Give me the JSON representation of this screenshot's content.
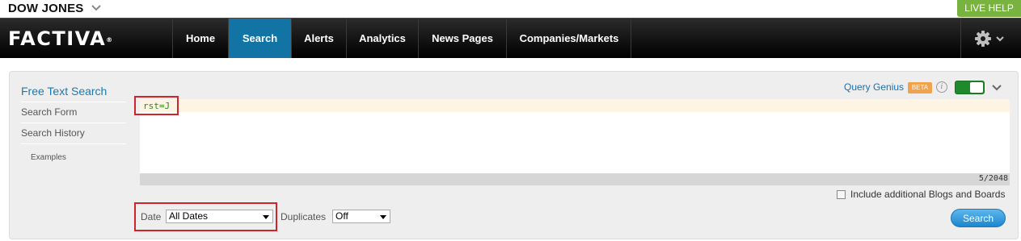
{
  "topbar": {
    "brand": "DOW JONES",
    "live_help": "LIVE HELP"
  },
  "nav": {
    "logo": "FACTIVA",
    "logo_mark": "®",
    "tabs": [
      {
        "label": "Home"
      },
      {
        "label": "Search",
        "active": true
      },
      {
        "label": "Alerts"
      },
      {
        "label": "Analytics"
      },
      {
        "label": "News Pages"
      },
      {
        "label": "Companies/Markets"
      }
    ]
  },
  "sidebar": {
    "items": [
      {
        "label": "Free Text Search",
        "active": true
      },
      {
        "label": "Search Form"
      },
      {
        "label": "Search History"
      },
      {
        "label": "Examples"
      }
    ]
  },
  "query_genius": {
    "label": "Query Genius",
    "badge": "BETA",
    "info": "i",
    "enabled": true
  },
  "editor": {
    "query": "rst=J",
    "counter": "5/2048"
  },
  "options": {
    "include_blogs_label": "Include additional Blogs and Boards",
    "include_blogs_checked": false,
    "date_label": "Date",
    "date_value": "All Dates",
    "duplicates_label": "Duplicates",
    "duplicates_value": "Off"
  },
  "actions": {
    "search_label": "Search"
  },
  "colors": {
    "active_tab": "#1174a4",
    "live_help": "#79b33f",
    "highlight": "#d1242a",
    "toggle_on": "#1f8a2b",
    "beta_badge": "#f0a24c",
    "search_button": "#1d86cf"
  }
}
